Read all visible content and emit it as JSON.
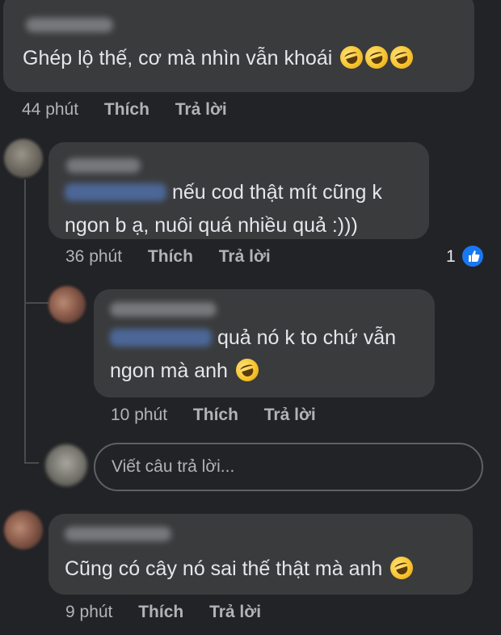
{
  "comments": [
    {
      "text": "Ghép lộ thế, cơ mà nhìn vẫn khoái",
      "emoji_count": 3,
      "emoji_icon": "rolling-on-floor-laughing-icon",
      "time": "44 phút",
      "like_label": "Thích",
      "reply_label": "Trả lời"
    },
    {
      "line1": "nếu cod thật mít cũng k",
      "line2": "ngon b ạ, nuôi quá nhiều quả :)))",
      "time": "36 phút",
      "like_label": "Thích",
      "reply_label": "Trả lời",
      "reaction_count": "1",
      "reaction_icon": "like-icon"
    },
    {
      "line1": "quả nó k to chứ vẫn",
      "line2": "ngon mà anh",
      "emoji_icon": "rolling-on-floor-laughing-icon",
      "time": "10 phút",
      "like_label": "Thích",
      "reply_label": "Trả lời"
    },
    {
      "text": "Cũng có cây nó sai thế thật mà anh",
      "emoji_icon": "rolling-on-floor-laughing-icon",
      "time": "9 phút",
      "like_label": "Thích",
      "reply_label": "Trả lời"
    }
  ],
  "reply_input": {
    "placeholder": "Viết câu trả lời..."
  },
  "colors": {
    "background": "#222326",
    "bubble": "#3a3b3c",
    "text": "#e4e6eb",
    "meta": "#b0b3b8",
    "like_blue": "#1877f2"
  }
}
